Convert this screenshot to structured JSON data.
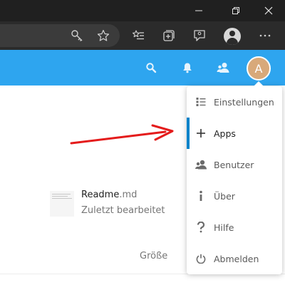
{
  "app": {
    "avatar_letter": "A",
    "header_color": "#2ea5ef"
  },
  "file": {
    "name": "Readme",
    "extension": ".md",
    "meta": "Zuletzt bearbeitet"
  },
  "table": {
    "size_header": "Größe"
  },
  "user_menu": {
    "items": [
      {
        "label": "Einstellungen",
        "icon": "settings-list-icon"
      },
      {
        "label": "Apps",
        "icon": "plus-icon",
        "active": true
      },
      {
        "label": "Benutzer",
        "icon": "users-icon"
      },
      {
        "label": "Über",
        "icon": "info-icon"
      },
      {
        "label": "Hilfe",
        "icon": "help-icon"
      },
      {
        "label": "Abmelden",
        "icon": "power-icon"
      }
    ]
  },
  "colors": {
    "accent": "#0082c9",
    "arrow": "#e41b1b"
  }
}
